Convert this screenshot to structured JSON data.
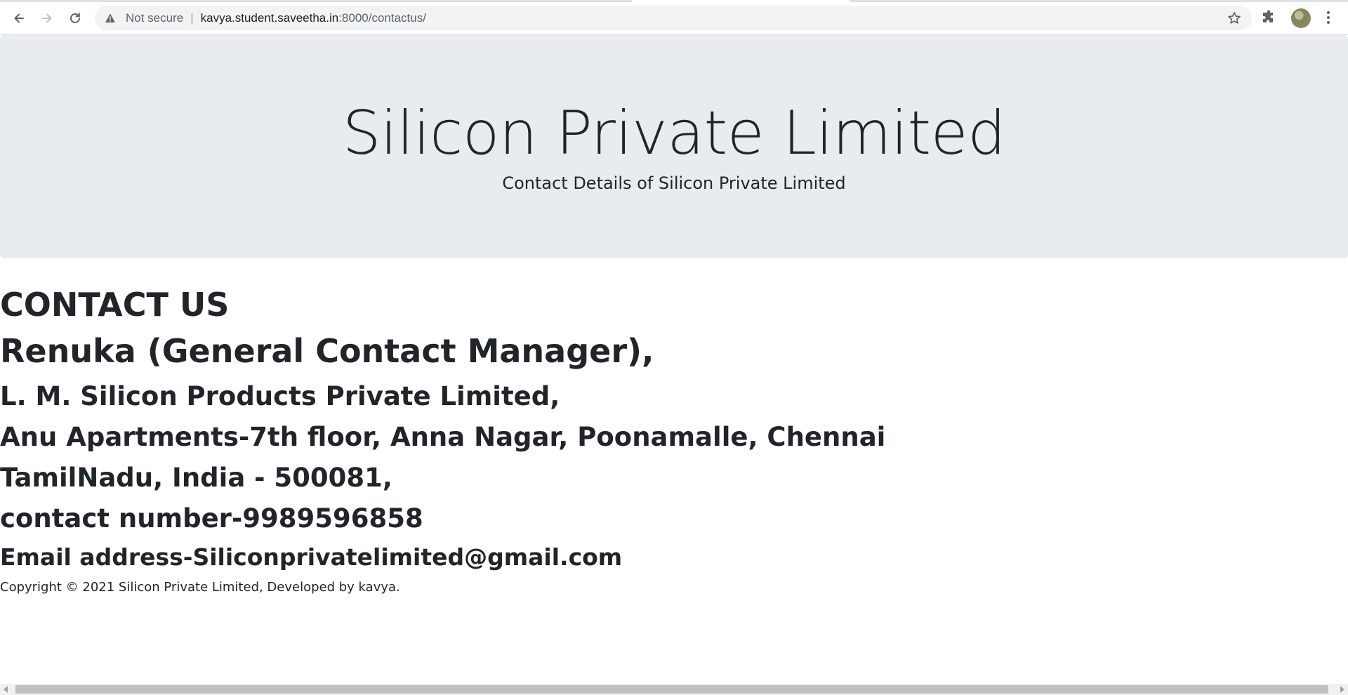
{
  "browser": {
    "security_label": "Not secure",
    "separator": "|",
    "url_host": "kavya.student.saveetha.in",
    "url_rest": ":8000/contactus/"
  },
  "jumbotron": {
    "title": "Silicon Private Limited",
    "subtitle": "Contact Details of Silicon Private Limited"
  },
  "contact": {
    "heading": "CONTACT US",
    "manager": "Renuka (General Contact Manager),",
    "company": "L. M. Silicon Products Private Limited,",
    "address": "Anu Apartments-7th floor, Anna Nagar, Poonamalle, Chennai",
    "state": "TamilNadu, India - 500081,",
    "phone": "contact number-9989596858",
    "email": "Email address-Siliconprivatelimited@gmail.com"
  },
  "footer": {
    "copyright": "Copyright © 2021 Silicon Private Limited, Developed by kavya."
  },
  "colors": {
    "jumbotron_bg": "#e9ecef",
    "text": "#212529",
    "omnibox_bg": "#f1f3f4"
  },
  "icons": [
    "back-arrow-icon",
    "forward-arrow-icon",
    "reload-icon",
    "warning-icon",
    "star-icon",
    "puzzle-extension-icon",
    "kebab-menu-icon"
  ]
}
